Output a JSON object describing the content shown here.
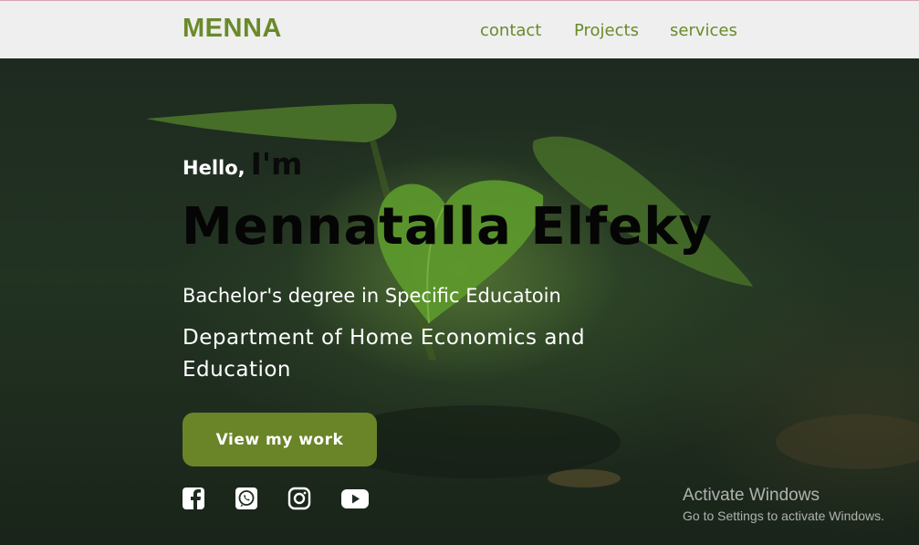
{
  "navbar": {
    "brand": "MENNA",
    "links": [
      {
        "label": "contact"
      },
      {
        "label": "Projects"
      },
      {
        "label": "services"
      }
    ]
  },
  "hero": {
    "greeting": "Hello,",
    "greeting_emphasis": "I'm",
    "name": "Mennatalla Elfeky",
    "degree": "Bachelor's degree in Specific Educatoin",
    "department": "Department of Home Economics and Education",
    "cta_label": "View my work"
  },
  "social": [
    {
      "icon": "facebook-icon"
    },
    {
      "icon": "whatsapp-icon"
    },
    {
      "icon": "instagram-icon"
    },
    {
      "icon": "youtube-icon"
    }
  ],
  "watermark": {
    "title": "Activate Windows",
    "subtitle": "Go to Settings to activate Windows."
  },
  "colors": {
    "accent": "#6a8a2a",
    "button": "#6a8428",
    "nav_bg": "#efefef"
  }
}
